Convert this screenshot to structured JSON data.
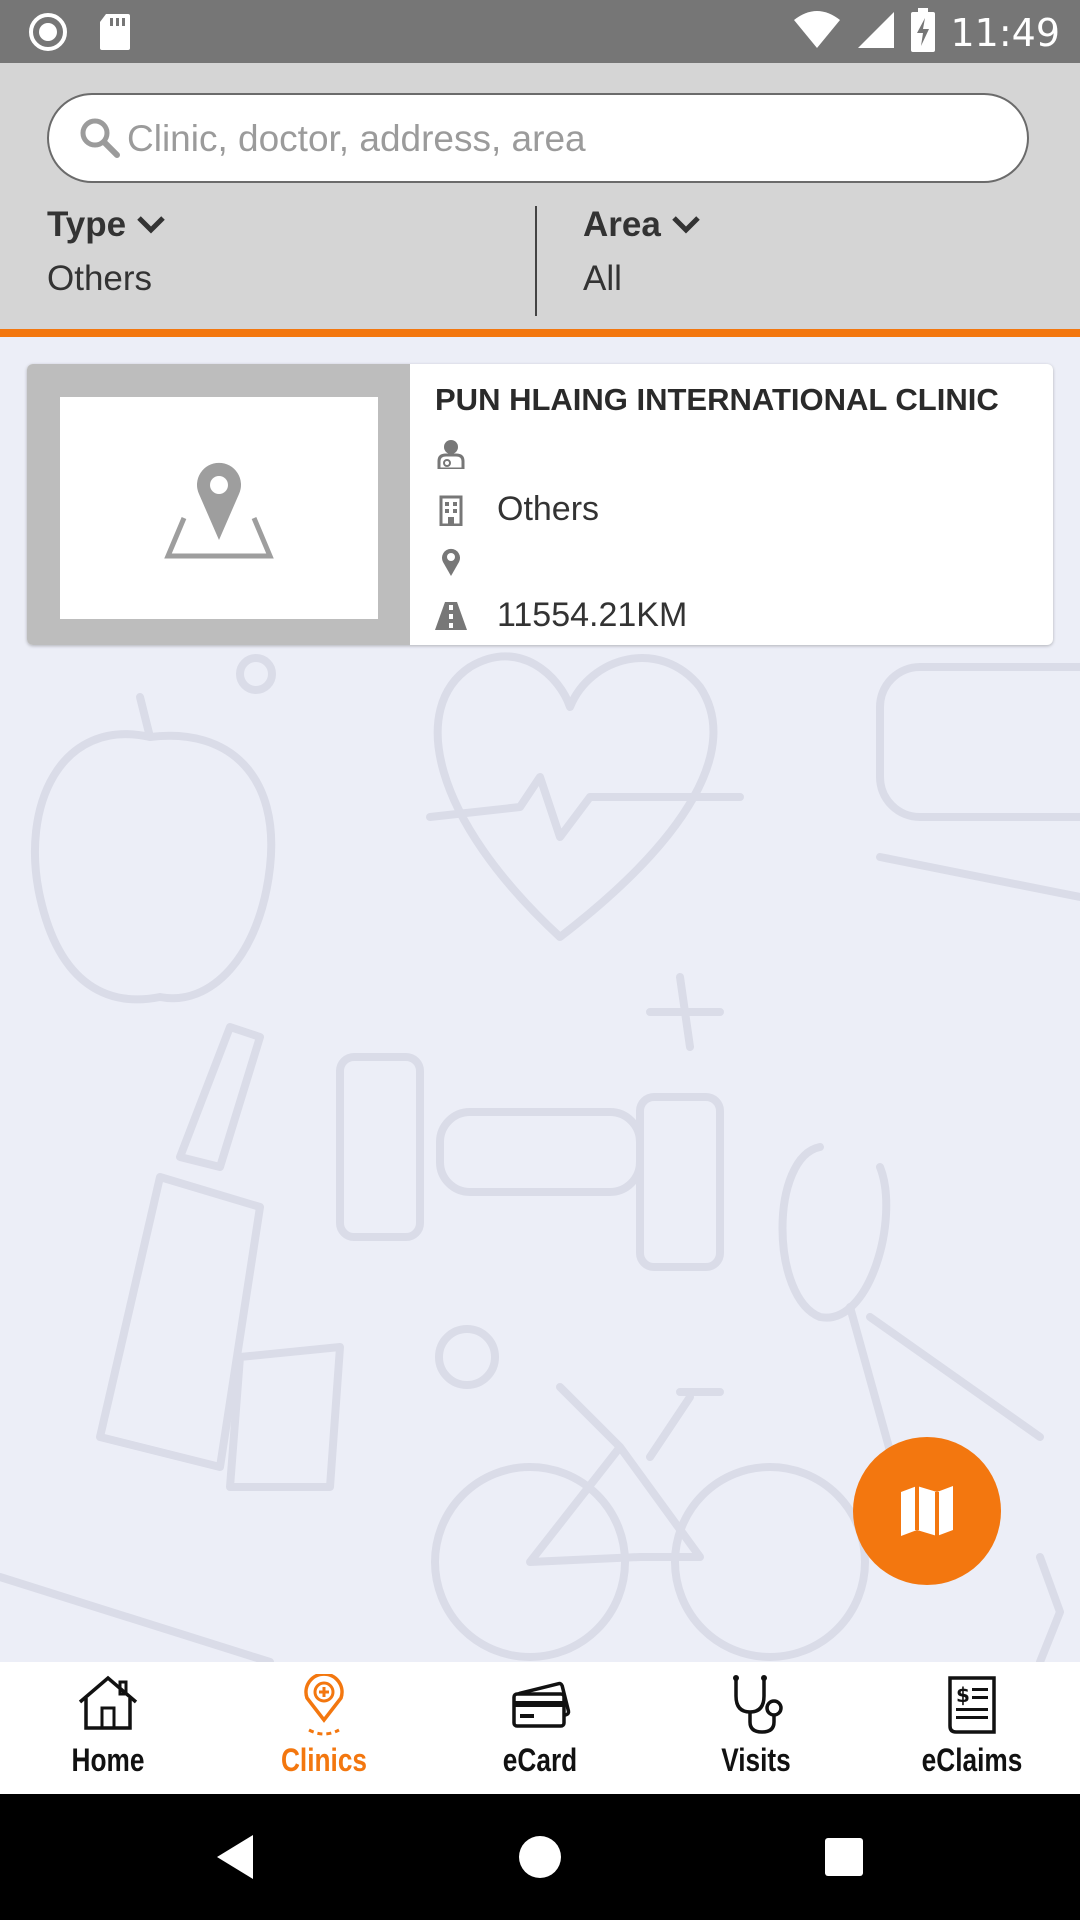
{
  "status_bar": {
    "time": "11:49"
  },
  "search": {
    "placeholder": "Clinic, doctor, address, area"
  },
  "filters": {
    "type": {
      "label": "Type",
      "value": "Others"
    },
    "area": {
      "label": "Area",
      "value": "All"
    }
  },
  "clinics": [
    {
      "name": "PUN HLAING INTERNATIONAL CLINIC",
      "doctor": "",
      "category": "Others",
      "address": "",
      "distance": "11554.21KM"
    }
  ],
  "bottom_nav": [
    {
      "label": "Home",
      "icon": "home-icon",
      "active": false
    },
    {
      "label": "Clinics",
      "icon": "clinic-location-icon",
      "active": true
    },
    {
      "label": "eCard",
      "icon": "ecard-icon",
      "active": false
    },
    {
      "label": "Visits",
      "icon": "stethoscope-icon",
      "active": false
    },
    {
      "label": "eClaims",
      "icon": "eclaims-icon",
      "active": false
    }
  ],
  "colors": {
    "accent": "#f3770f",
    "header_bg": "#d5d5d5",
    "status_bar": "#767676",
    "page_bg": "#eceef7"
  }
}
